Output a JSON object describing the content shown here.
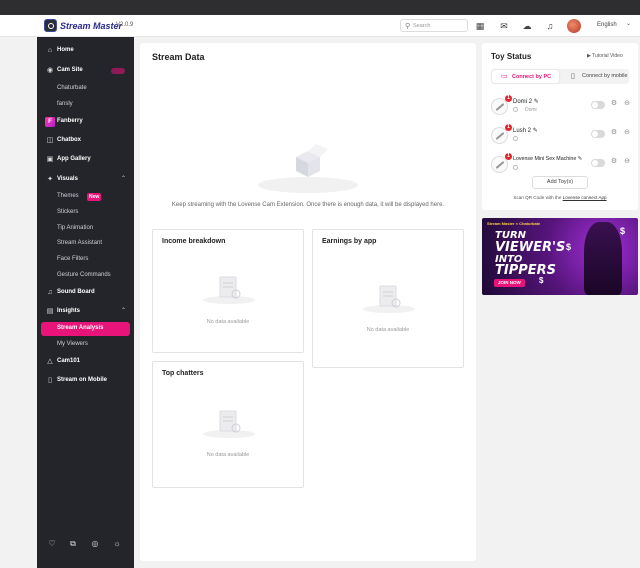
{
  "app": {
    "name": "Stream Master",
    "version": "V2.0.9"
  },
  "header": {
    "search_placeholder": "Search",
    "language": "English"
  },
  "sidebar": {
    "home": "Home",
    "cam_site": "Cam Site",
    "chaturbate": "Chaturbate",
    "fansly": "fansly",
    "fanberry": "Fanberry",
    "chatbox": "Chatbox",
    "app_gallery": "App Gallery",
    "visuals": "Visuals",
    "themes": "Themes",
    "new_badge": "New",
    "stickers": "Stickers",
    "tip_animation": "Tip Animation",
    "stream_assistant": "Stream Assistant",
    "face_filters": "Face Filters",
    "gesture_commands": "Gesture Commands",
    "sound_board": "Sound Board",
    "insights": "Insights",
    "stream_analysis": "Stream Analysis",
    "my_viewers": "My Viewers",
    "cam101": "Cam101",
    "stream_on_mobile": "Stream on Mobile"
  },
  "main": {
    "title": "Stream Data",
    "info": "Keep streaming with the Lovense Cam Extension. Once there is enough data, it will be displayed here.",
    "income_title": "Income breakdown",
    "earnings_title": "Earnings by app",
    "chatters_title": "Top chatters",
    "no_data": "No data available"
  },
  "toys": {
    "title": "Toy Status",
    "tutorial": "Tutorial Video",
    "connect_pc": "Connect by PC",
    "connect_mobile": "Connect by mobile",
    "items": [
      {
        "name": "Domi 2",
        "badge": "1",
        "sub": "Domi"
      },
      {
        "name": "Lush 2",
        "badge": "1",
        "sub": ""
      },
      {
        "name": "Lovense Mini Sex Machine",
        "badge": "1",
        "sub": ""
      }
    ],
    "add_button": "Add Toy(s)",
    "scan_text": "Scan QR Code with the ",
    "scan_link": "Lovense connect App"
  },
  "banner": {
    "tag": "Stream Master × Chaturbate",
    "line1": "TURN",
    "line2": "VIEWER'S",
    "line3": "INTO",
    "line4": "TIPPERS",
    "cta": "JOIN NOW",
    "dollar": "$"
  }
}
